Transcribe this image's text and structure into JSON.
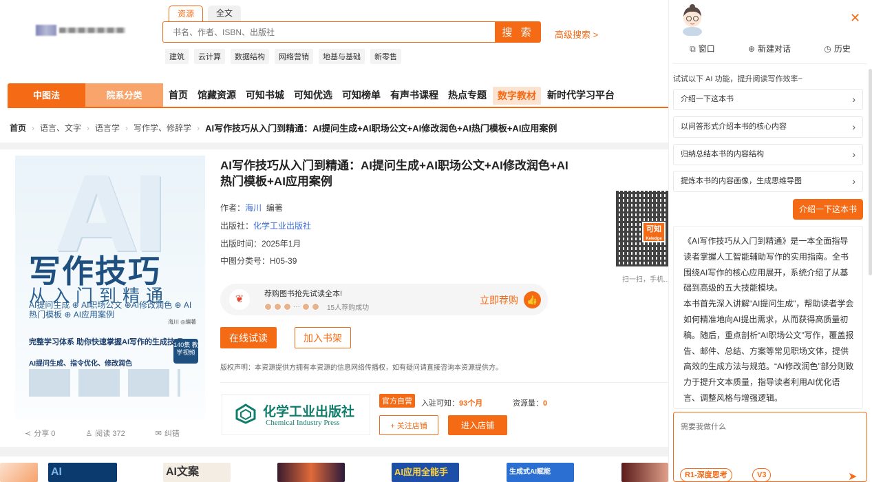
{
  "search": {
    "tabs": [
      "资源",
      "全文"
    ],
    "placeholder": "书名、作者、ISBN、出版社",
    "button": "搜 索",
    "advanced": "高级搜索 >",
    "hot_tags": [
      "建筑",
      "云计算",
      "数据结构",
      "网络营销",
      "地基与基础",
      "新零售"
    ]
  },
  "nav": {
    "left": [
      "中图法",
      "院系分类"
    ],
    "items": [
      "首页",
      "馆藏资源",
      "可知书城",
      "可知优选",
      "可知榜单",
      "有声书课程",
      "热点专题",
      "数字教材",
      "新时代学习平台"
    ]
  },
  "breadcrumb": [
    "首页",
    "语言、文字",
    "语言学",
    "写作学、修辞学",
    "AI写作技巧从入门到精通：AI提问生成+AI职场公文+AI修改润色+AI热门模板+AI应用案例"
  ],
  "book": {
    "title": "AI写作技巧从入门到精通：AI提问生成+AI职场公文+AI修改润色+AI热门模板+AI应用案例",
    "author_label": "作者：",
    "author": "海川",
    "author_role": "编著",
    "publisher_label": "出版社：",
    "publisher": "化学工业出版社",
    "date_label": "出版时间：",
    "date": "2025年1月",
    "class_label": "中图分类号：",
    "class": "H05-39",
    "cover": {
      "big": "AI",
      "t1": "写作技巧",
      "t2": "从入门到精通",
      "t3": "AI提问生成 ⊕ AI职场公文 ⊕AI修改润色 ⊕ AI热门模板 ⊕ AI应用案例",
      "t4": "海川 ◎编著",
      "t5": "完整学习体系 助你快速掌握AI写作的生成技巧",
      "t6": "AI提问生成、指令优化、修改润色",
      "badge": "140集 教学视频"
    },
    "actions": [
      "分享 0",
      "阅读 372",
      "纠错"
    ],
    "qr_text": "扫一扫，手机..."
  },
  "recommend": {
    "text": "荐购图书抢先试读全本!",
    "count": "15人荐购成功",
    "button": "立即荐购"
  },
  "buttons": {
    "try": "在线试读",
    "shelf": "加入书架"
  },
  "copyright": "版权声明：本资源提供方拥有本资源的信息网络传播权，如有疑问请直接咨询本资源提供方。",
  "publisher_card": {
    "name": "化学工业出版社",
    "en": "Chemical Industry Press",
    "tag": "官方自营",
    "joined_label": "入驻可知：",
    "joined": "93个月",
    "resources_label": "资源量：",
    "resources": "0",
    "follow": "+ 关注店铺",
    "enter": "进入店铺"
  },
  "bottom_books": [
    "AI",
    "AI文案",
    "",
    "AI应用全能手",
    "生成式AI赋能",
    ""
  ],
  "ai": {
    "tabs": [
      "窗口",
      "新建对话",
      "历史"
    ],
    "tip": "试试以下 AI 功能，提升阅读写作效率~",
    "suggestions": [
      "介绍一下这本书",
      "以问答形式介绍本书的核心内容",
      "归纳总结本书的内容结构",
      "提炼本书的内容画像，生成思维导图"
    ],
    "user_msg": "介绍一下这本书",
    "answer_p1": "《AI写作技巧从入门到精通》是一本全面指导读者掌握人工智能辅助写作的实用指南。全书围绕AI写作的核心应用展开，系统介绍了从基础到高级的五大技能模块。",
    "answer_p2": "本书首先深入讲解“AI提问生成”，帮助读者学会如何精准地向AI提出需求，从而获得高质量初稿。随后，重点剖析“AI职场公文”写作，覆盖报告、邮件、总结、方案等常见职场文体，提供高效的生成方法与规范。“AI修改润色”部分则致力于提升文本质量，指导读者利用AI优化语言、调整风格与增强逻辑。",
    "input_placeholder": "需要我做什么",
    "chips": [
      "R1-深度思考",
      "V3"
    ]
  }
}
